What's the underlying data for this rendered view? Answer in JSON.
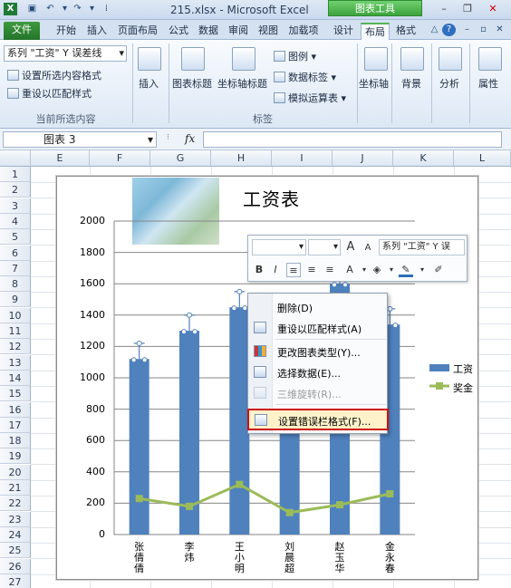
{
  "window": {
    "title": "215.xlsx - Microsoft Excel",
    "context_tools": "图表工具",
    "quick_access": [
      "save-icon",
      "undo-icon",
      "redo-icon"
    ]
  },
  "tabs": [
    "文件",
    "开始",
    "插入",
    "页面布局",
    "公式",
    "数据",
    "审阅",
    "视图",
    "加载项",
    "设计",
    "布局",
    "格式"
  ],
  "active_tab": "布局",
  "ribbon": {
    "selection_dropdown": "系列 \"工资\" Y 误差线",
    "format_selection": "设置所选内容格式",
    "reset_style": "重设以匹配样式",
    "group_current": "当前所选内容",
    "insert": "插入",
    "chart_title": "图表标题",
    "axis_title": "坐标轴标题",
    "legend": "图例",
    "data_labels": "数据标签",
    "data_table": "模拟运算表",
    "group_labels": "标签",
    "axes": "坐标轴",
    "background": "背景",
    "analysis": "分析",
    "properties": "属性"
  },
  "formula_bar": {
    "name_box": "图表 3",
    "fx": "fx",
    "value": ""
  },
  "columns": [
    "E",
    "F",
    "G",
    "H",
    "I",
    "J",
    "K",
    "L"
  ],
  "rows": [
    "1",
    "2",
    "3",
    "4",
    "5",
    "6",
    "7",
    "8",
    "9",
    "10",
    "11",
    "12",
    "13",
    "14",
    "15",
    "16",
    "17",
    "18",
    "19",
    "20",
    "21",
    "22",
    "23",
    "24",
    "25",
    "26",
    "27"
  ],
  "chart_data": {
    "type": "bar",
    "title": "工资表",
    "categories": [
      "张倩倩",
      "李炜",
      "王小明",
      "刘晨超",
      "赵玉华",
      "金永春"
    ],
    "series": [
      {
        "name": "工资",
        "type": "bar",
        "color": "#4f81bd",
        "values": [
          1120,
          1300,
          1450,
          1250,
          1600,
          1340
        ]
      },
      {
        "name": "奖金",
        "type": "line",
        "color": "#9bbb59",
        "values": [
          230,
          180,
          320,
          140,
          190,
          260
        ]
      }
    ],
    "yticks": [
      "2000",
      "1800",
      "1600",
      "1400",
      "1200",
      "1000",
      "800",
      "600",
      "400",
      "200",
      "0"
    ],
    "ylim": [
      0,
      2000
    ],
    "error_bars": true,
    "legend_labels": [
      "工资",
      "奖金"
    ],
    "legend_position": "right"
  },
  "mini_toolbar": {
    "font_size_up": "A",
    "font_size_down": "A",
    "element": "系列 \"工资\" Y 误",
    "bold": "B",
    "italic": "I"
  },
  "context_menu": [
    {
      "label": "删除(D)",
      "icon": "",
      "enabled": true
    },
    {
      "label": "重设以匹配样式(A)",
      "icon": "reset-icon",
      "enabled": true
    },
    {
      "label": "更改图表类型(Y)...",
      "icon": "chart-type-icon",
      "enabled": true
    },
    {
      "label": "选择数据(E)...",
      "icon": "select-data-icon",
      "enabled": true
    },
    {
      "label": "三维旋转(R)...",
      "icon": "rotate-3d-icon",
      "enabled": false
    },
    {
      "label": "设置错误栏格式(F)...",
      "icon": "format-icon",
      "enabled": true
    }
  ]
}
